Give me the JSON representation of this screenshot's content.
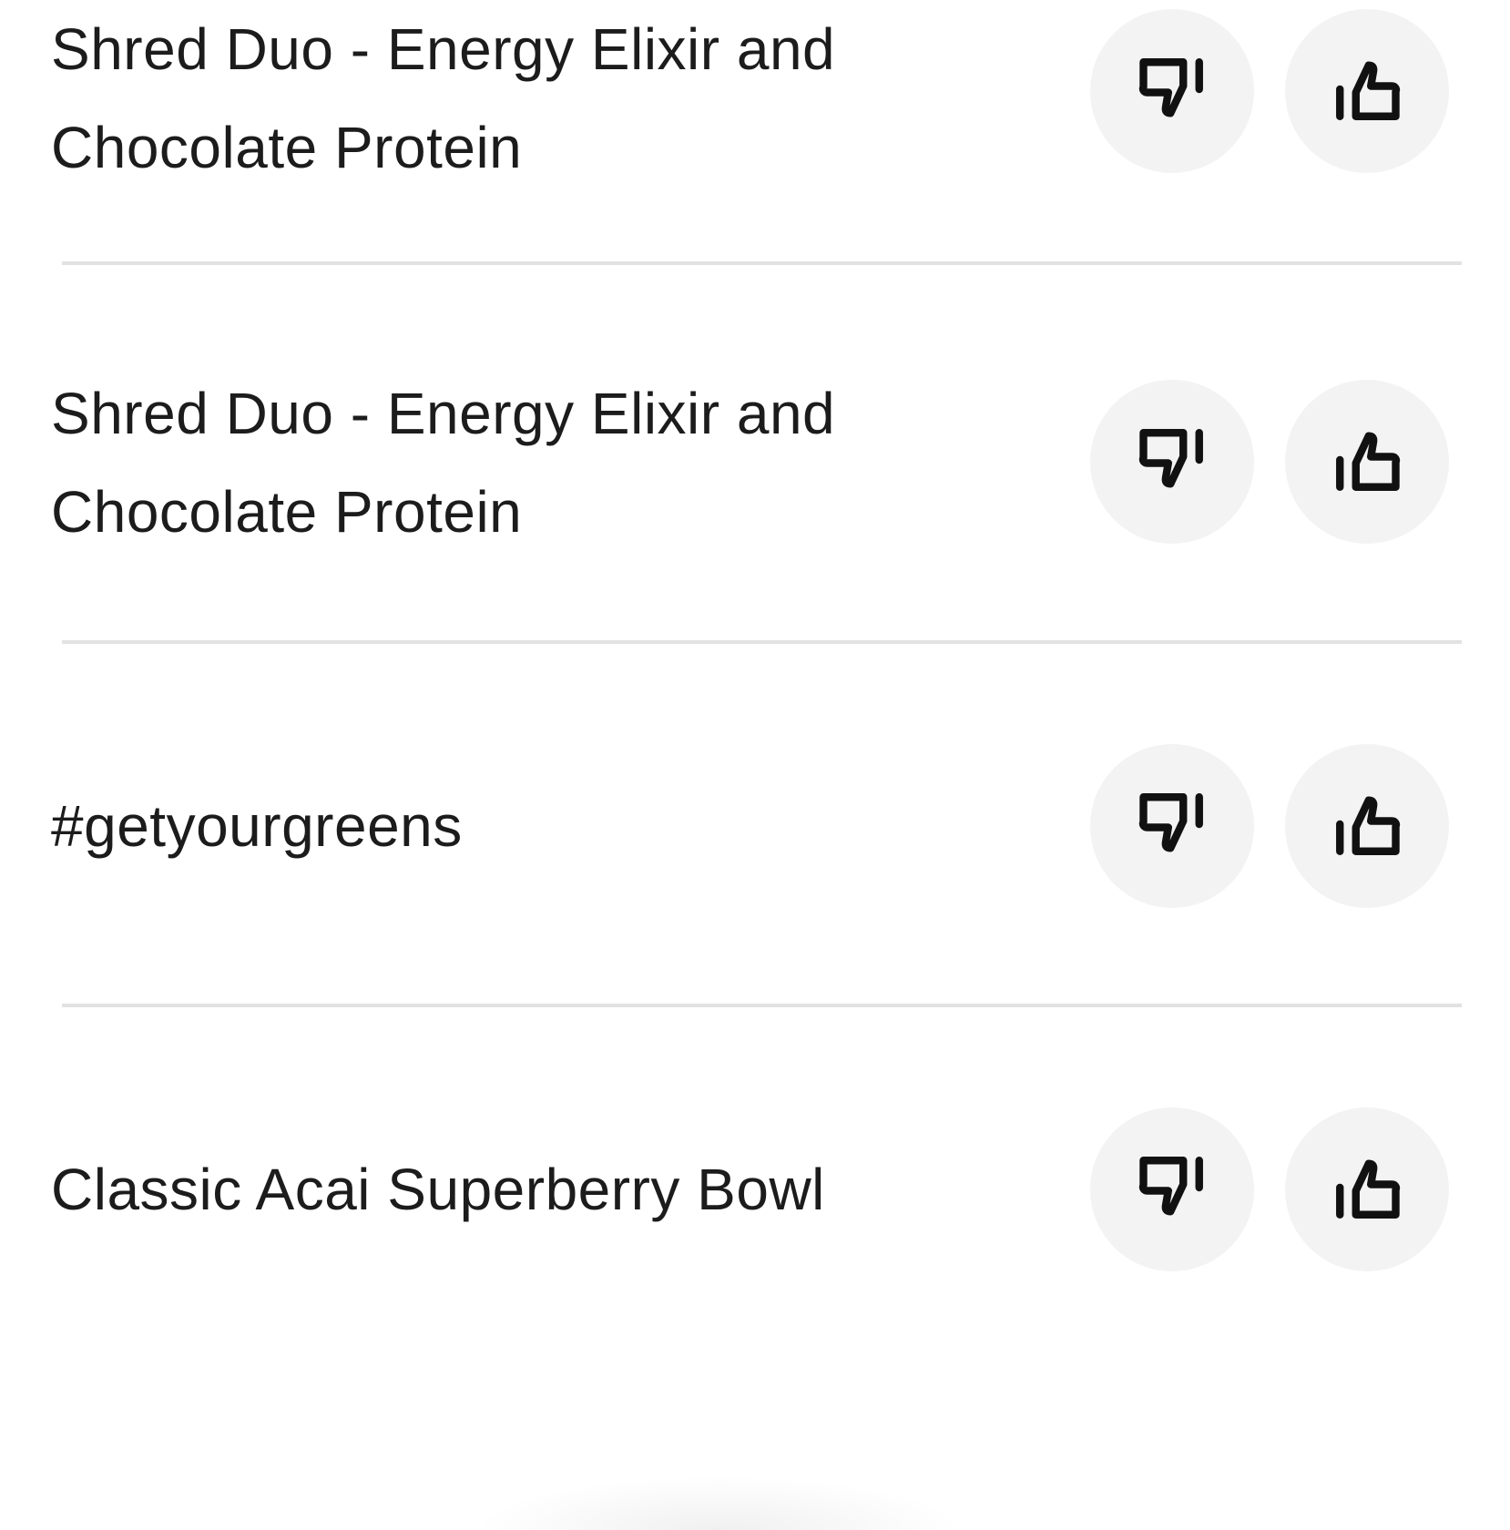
{
  "items": [
    {
      "name": "Shred Duo - Energy Elixir and Chocolate Protein",
      "dislike_icon": "thumbs-down-icon",
      "like_icon": "thumbs-up-icon"
    },
    {
      "name": "Shred Duo - Energy Elixir and Chocolate Protein",
      "dislike_icon": "thumbs-down-icon",
      "like_icon": "thumbs-up-icon"
    },
    {
      "name": "#getyourgreens",
      "dislike_icon": "thumbs-down-icon",
      "like_icon": "thumbs-up-icon"
    },
    {
      "name": "Classic Acai Superberry Bowl",
      "dislike_icon": "thumbs-down-icon",
      "like_icon": "thumbs-up-icon"
    }
  ],
  "colors": {
    "button_background": "#f3f3f3",
    "divider": "#e2e2e2",
    "text": "#1c1c1c",
    "icon": "#111111"
  }
}
